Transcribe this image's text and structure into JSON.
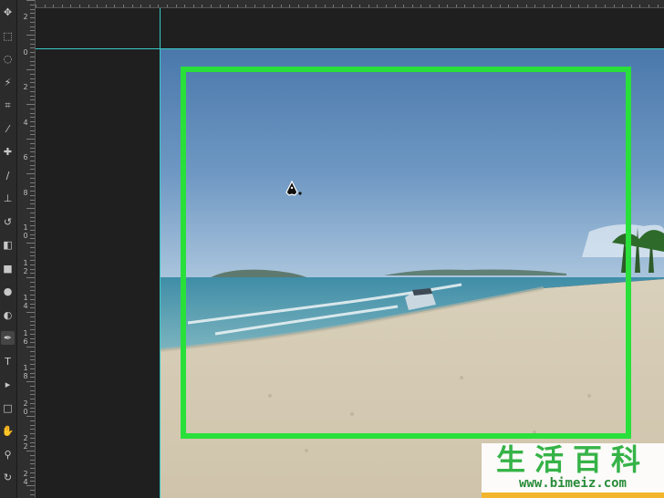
{
  "app": {
    "accent_color": "#29e03a",
    "guide_color": "#37c8c8",
    "canvas_background": "#1f1f1f"
  },
  "toolbar": {
    "tools": [
      {
        "name": "move-tool-icon",
        "glyph": "✥"
      },
      {
        "name": "marquee-tool-icon",
        "glyph": "⬚"
      },
      {
        "name": "lasso-tool-icon",
        "glyph": "◌"
      },
      {
        "name": "magic-wand-tool-icon",
        "glyph": "⚡"
      },
      {
        "name": "crop-tool-icon",
        "glyph": "⌗"
      },
      {
        "name": "eyedropper-tool-icon",
        "glyph": "⁄"
      },
      {
        "name": "healing-brush-tool-icon",
        "glyph": "✚"
      },
      {
        "name": "brush-tool-icon",
        "glyph": "∕"
      },
      {
        "name": "clone-stamp-tool-icon",
        "glyph": "⊥"
      },
      {
        "name": "history-brush-tool-icon",
        "glyph": "↺"
      },
      {
        "name": "eraser-tool-icon",
        "glyph": "◧"
      },
      {
        "name": "gradient-tool-icon",
        "glyph": "■"
      },
      {
        "name": "blur-tool-icon",
        "glyph": "●"
      },
      {
        "name": "dodge-tool-icon",
        "glyph": "◐"
      },
      {
        "name": "pen-tool-icon",
        "glyph": "✒"
      },
      {
        "name": "type-tool-icon",
        "glyph": "T"
      },
      {
        "name": "path-selection-tool-icon",
        "glyph": "▸"
      },
      {
        "name": "shape-tool-icon",
        "glyph": "□"
      },
      {
        "name": "hand-tool-icon",
        "glyph": "✋"
      },
      {
        "name": "zoom-tool-icon",
        "glyph": "⚲"
      },
      {
        "name": "rotate-view-tool-icon",
        "glyph": "↻"
      }
    ],
    "active_tool": "pen-tool-icon"
  },
  "vertical_ruler": {
    "labels": [
      "2",
      "0",
      "2",
      "4",
      "6",
      "8",
      "10",
      "12",
      "14",
      "16",
      "18",
      "20",
      "22",
      "24"
    ]
  },
  "watermark": {
    "title": "生活百科",
    "url": "www.bimeiz.com"
  }
}
